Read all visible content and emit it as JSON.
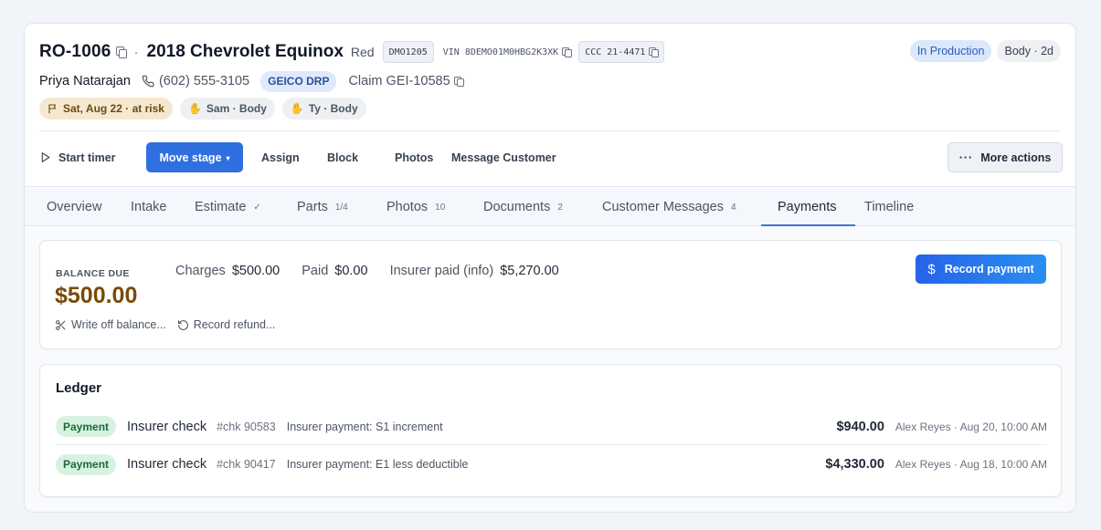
{
  "order": {
    "ro_number": "RO-1006",
    "separator": "·",
    "vehicle": "2018 Chevrolet Equinox",
    "color": "Red",
    "dms_code": "DMO1205",
    "vin": "VIN 8DEMO01M0HBG2K3XK",
    "ccc": "CCC 21-4471",
    "status": "In Production",
    "department": "Body · 2d"
  },
  "customer": {
    "name": "Priya Natarajan",
    "phone": "(602) 555-3105",
    "insurer": "GEICO DRP",
    "claim": "Claim GEI-10585"
  },
  "tags": {
    "due": "Sat, Aug 22 · at risk",
    "tech1": "Sam · Body",
    "tech2": "Ty · Body"
  },
  "actions": {
    "start_timer": "Start timer",
    "move_stage": "Move stage",
    "assign": "Assign",
    "block": "Block",
    "photos": "Photos",
    "message_customer": "Message Customer",
    "more_actions": "More actions"
  },
  "tabs": [
    {
      "label": "Overview",
      "count": ""
    },
    {
      "label": "Intake",
      "count": ""
    },
    {
      "label": "Estimate",
      "count": "✓"
    },
    {
      "label": "Parts",
      "count": "1/4"
    },
    {
      "label": "Photos",
      "count": "10"
    },
    {
      "label": "Documents",
      "count": "2"
    },
    {
      "label": "Customer Messages",
      "count": "4"
    },
    {
      "label": "Payments",
      "count": ""
    },
    {
      "label": "Timeline",
      "count": ""
    }
  ],
  "active_tab": "Payments",
  "balance": {
    "label": "BALANCE DUE",
    "amount": "$500.00",
    "charges_label": "Charges",
    "charges_value": "$500.00",
    "paid_label": "Paid",
    "paid_value": "$0.00",
    "insurer_label": "Insurer paid (info)",
    "insurer_value": "$5,270.00",
    "write_off": "Write off balance...",
    "record_refund": "Record refund...",
    "record_payment": "Record payment"
  },
  "ledger": {
    "title": "Ledger",
    "rows": [
      {
        "type": "Payment",
        "method": "Insurer check",
        "ref": "#chk 90583",
        "memo": "Insurer payment: S1 increment",
        "amount": "$940.00",
        "by": "Alex Reyes · Aug 20, 10:00 AM"
      },
      {
        "type": "Payment",
        "method": "Insurer check",
        "ref": "#chk 90417",
        "memo": "Insurer payment: E1 less deductible",
        "amount": "$4,330.00",
        "by": "Alex Reyes · Aug 18, 10:00 AM"
      }
    ]
  },
  "colors": {
    "primary": "#2f6fe0",
    "balance_amount": "#7a4a06",
    "status_pill": "#dbe7fb",
    "payment_badge": "#d7f2e0"
  }
}
